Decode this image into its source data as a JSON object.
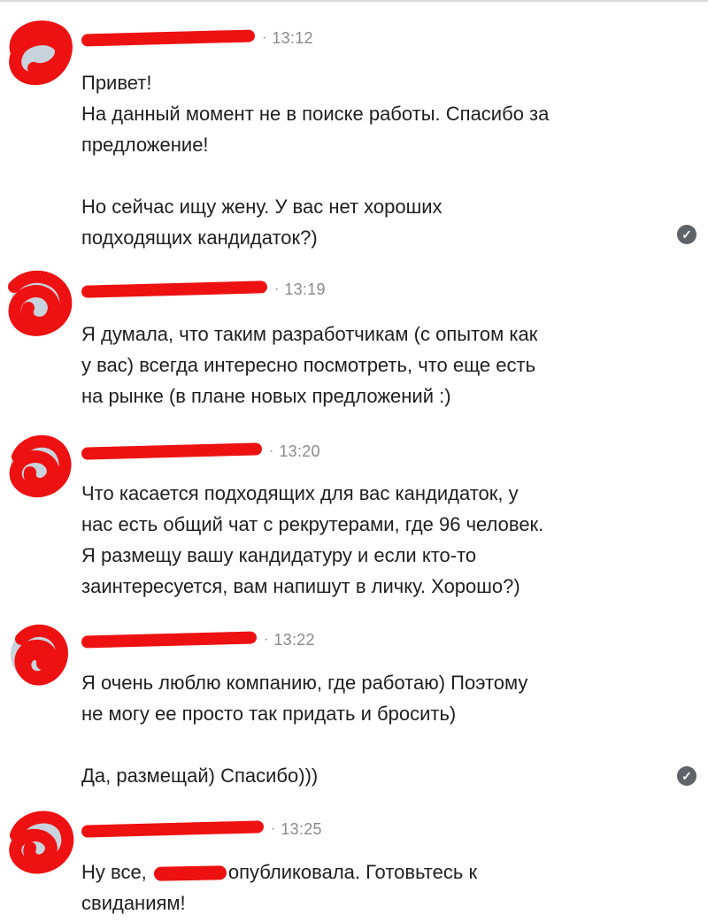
{
  "colors": {
    "redaction": "#ee1111",
    "timestamp": "#8a8a8a",
    "text": "#1f1f1f",
    "check_bg": "#5f6368"
  },
  "messages": [
    {
      "time": "13:12",
      "lines": [
        "Привет!",
        "На данный момент не в поиске работы. Спасибо за",
        "предложение!",
        "",
        "Но сейчас ищу жену. У вас нет хороших",
        "подходящих кандидаток?)"
      ],
      "read_icon": "check-circle-icon"
    },
    {
      "time": "13:19",
      "lines": [
        "Я думала, что таким разработчикам (с опытом как",
        "у вас) всегда интересно посмотреть, что еще есть",
        "на рынке (в плане новых предложений :)"
      ]
    },
    {
      "time": "13:20",
      "lines": [
        "Что касается подходящих для вас кандидаток, у",
        "нас есть общий чат с рекрутерами, где 96 человек.",
        "Я размещу вашу кандидатуру и если кто-то",
        "заинтересуется, вам напишут в личку. Хорошо?)"
      ]
    },
    {
      "time": "13:22",
      "lines": [
        "Я очень люблю компанию, где работаю) Поэтому",
        "не могу ее просто так придать и бросить)",
        "",
        "Да, размещай) Спасибо)))"
      ],
      "read_icon": "check-circle-icon"
    },
    {
      "time": "13:25",
      "lines_before_redaction": "Ну все, ",
      "lines_after_redaction": "опубликовала. Готовьтесь к",
      "last_line": "свиданиям!"
    }
  ],
  "separator": "·",
  "check_glyph": "✓"
}
